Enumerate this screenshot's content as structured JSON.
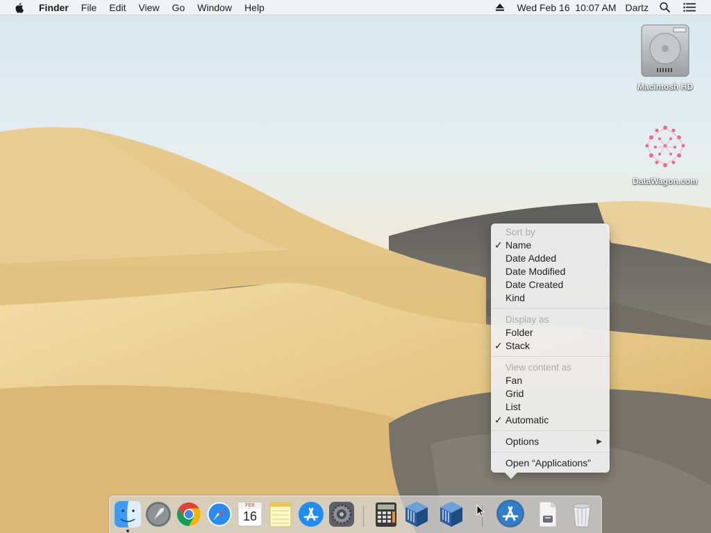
{
  "menubar": {
    "apple_icon": "apple-logo-icon",
    "app_name": "Finder",
    "menus": [
      "File",
      "Edit",
      "View",
      "Go",
      "Window",
      "Help"
    ],
    "datetime": "Wed Feb 16  10:07 AM",
    "user": "Dartz",
    "right_icons": [
      "eject-icon",
      "search-icon",
      "control-center-list-icon"
    ]
  },
  "desktop_icons": [
    {
      "label": "Macintosh HD",
      "icon": "hard-drive-icon"
    },
    {
      "label": "DataWagon.com",
      "icon": "datawagon-logo-icon"
    }
  ],
  "context_menu": {
    "sections": [
      {
        "header": "Sort by",
        "items": [
          {
            "label": "Name",
            "checked": true
          },
          {
            "label": "Date Added",
            "checked": false
          },
          {
            "label": "Date Modified",
            "checked": false
          },
          {
            "label": "Date Created",
            "checked": false
          },
          {
            "label": "Kind",
            "checked": false
          }
        ]
      },
      {
        "header": "Display as",
        "items": [
          {
            "label": "Folder",
            "checked": false
          },
          {
            "label": "Stack",
            "checked": true
          }
        ]
      },
      {
        "header": "View content as",
        "items": [
          {
            "label": "Fan",
            "checked": false
          },
          {
            "label": "Grid",
            "checked": false
          },
          {
            "label": "List",
            "checked": false
          },
          {
            "label": "Automatic",
            "checked": true
          }
        ]
      }
    ],
    "options_label": "Options",
    "open_label": "Open “Applications”",
    "checkmark": "✓",
    "submenu_arrow": "▶"
  },
  "dock": {
    "apps": [
      {
        "name": "Finder",
        "icon": "finder-icon",
        "running": true
      },
      {
        "name": "Launchpad",
        "icon": "launchpad-icon",
        "running": false
      },
      {
        "name": "Google Chrome",
        "icon": "chrome-icon",
        "running": false
      },
      {
        "name": "Safari",
        "icon": "safari-icon",
        "running": false
      },
      {
        "name": "Calendar",
        "icon": "calendar-icon",
        "running": false,
        "month": "FEB",
        "day": "16"
      },
      {
        "name": "Notes",
        "icon": "notes-icon",
        "running": false
      },
      {
        "name": "App Store",
        "icon": "app-store-icon",
        "running": false
      },
      {
        "name": "System Preferences",
        "icon": "system-preferences-icon",
        "running": false
      },
      {
        "name": "Calculator",
        "icon": "calculator-icon",
        "running": false
      },
      {
        "name": "VirtualBox",
        "icon": "virtualbox-icon",
        "running": false
      },
      {
        "name": "VirtualBox",
        "icon": "virtualbox-icon",
        "running": false
      }
    ],
    "stacks": [
      {
        "name": "Applications",
        "icon": "applications-folder-icon"
      },
      {
        "name": "Document",
        "icon": "document-icon"
      },
      {
        "name": "Trash",
        "icon": "trash-icon"
      }
    ]
  },
  "colors": {
    "menu_bg": "#ececec",
    "menu_header": "#ababab",
    "sky": "#d7e7ef",
    "sand": "#e2c07f"
  }
}
